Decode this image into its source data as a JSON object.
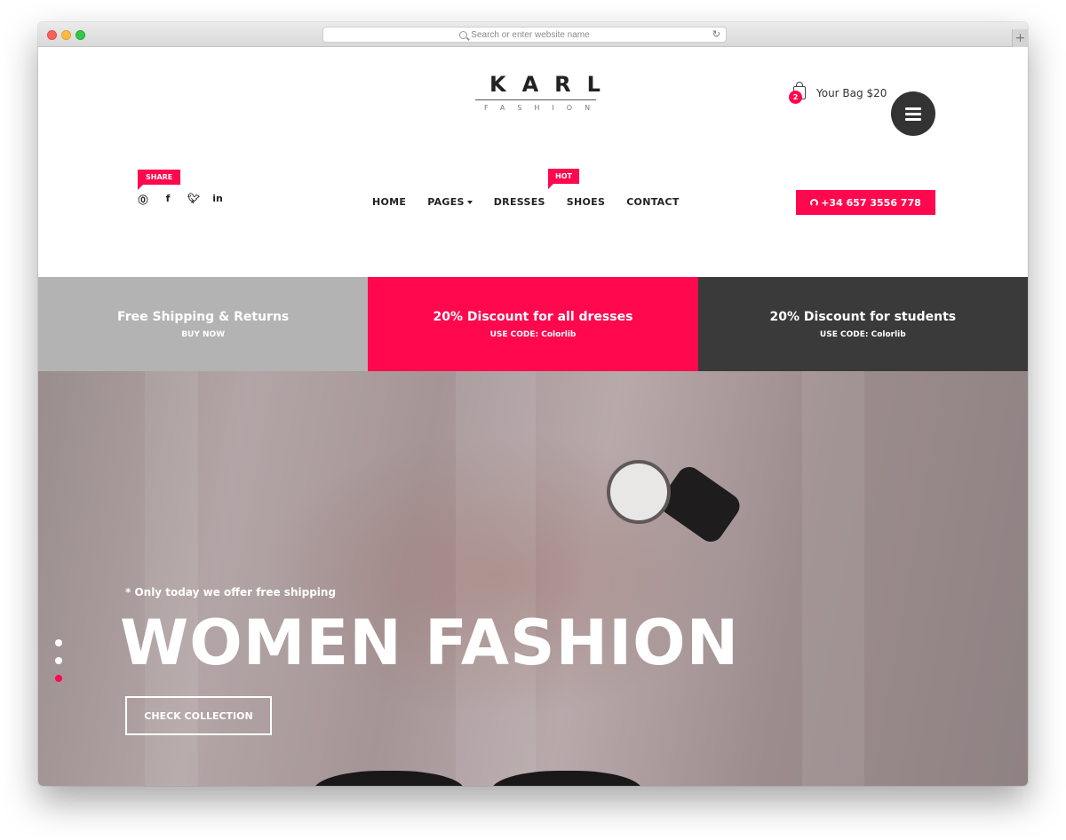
{
  "browser": {
    "address_placeholder": "Search or enter website name",
    "newtab_label": "+"
  },
  "header": {
    "logo_main": "KARL",
    "logo_sub": "FASHION",
    "bag_count": "2",
    "bag_label": "Your Bag $20",
    "share_label": "SHARE",
    "hot_label": "HOT",
    "phone": "+34 657 3556 778",
    "social_icons": [
      "pinterest-icon",
      "facebook-icon",
      "twitter-icon",
      "linkedin-icon"
    ]
  },
  "nav": {
    "items": [
      {
        "label": "HOME"
      },
      {
        "label": "PAGES"
      },
      {
        "label": "DRESSES"
      },
      {
        "label": "SHOES"
      },
      {
        "label": "CONTACT"
      }
    ]
  },
  "promo": [
    {
      "title": "Free Shipping & Returns",
      "sub": "BUY NOW",
      "color": "#b3b3b3"
    },
    {
      "title": "20% Discount for all dresses",
      "sub": "USE CODE: Colorlib",
      "color": "#ff084e"
    },
    {
      "title": "20% Discount for students",
      "sub": "USE CODE: Colorlib",
      "color": "#3a3a3a"
    }
  ],
  "hero": {
    "note": "* Only today we offer free shipping",
    "title": "WOMEN FASHION",
    "button": "CHECK COLLECTION"
  },
  "colors": {
    "accent": "#ff084e",
    "dark": "#333333"
  }
}
